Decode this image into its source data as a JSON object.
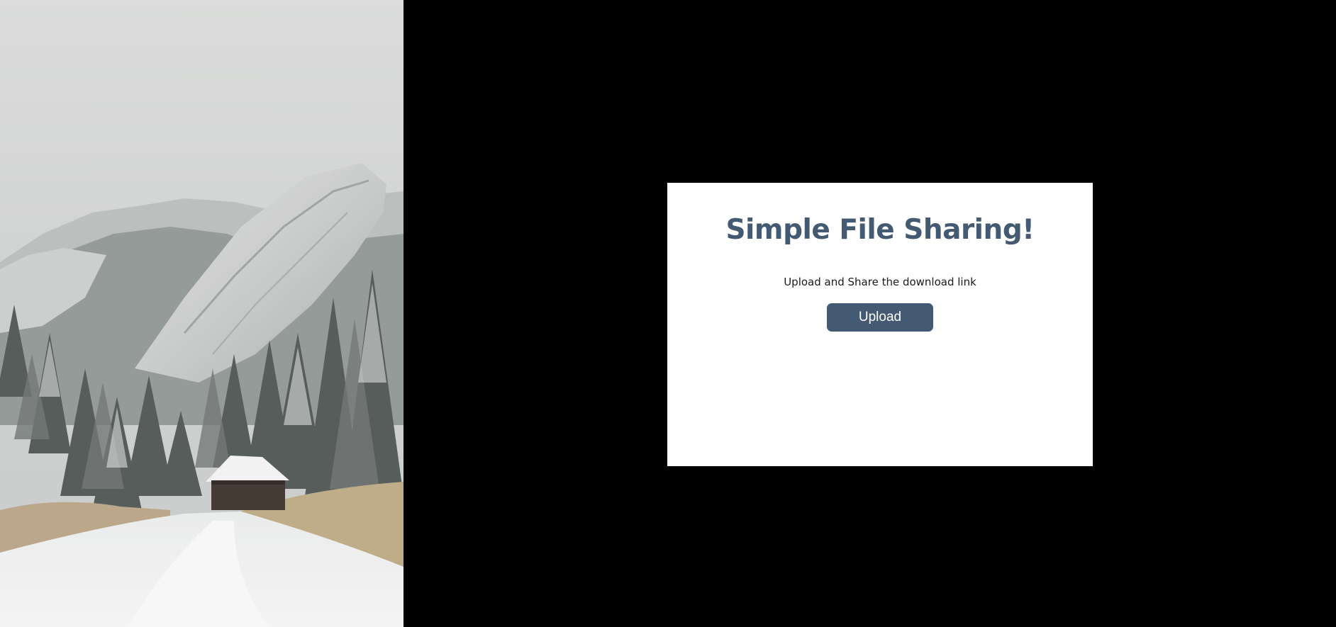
{
  "hero": {
    "description_icon": "snowy-mountain-cabin-image"
  },
  "card": {
    "title": "Simple File Sharing!",
    "subtitle": "Upload and Share the download link",
    "upload_label": "Upload"
  },
  "colors": {
    "accent": "#435a72",
    "page_background": "#000000",
    "card_background": "#ffffff"
  }
}
